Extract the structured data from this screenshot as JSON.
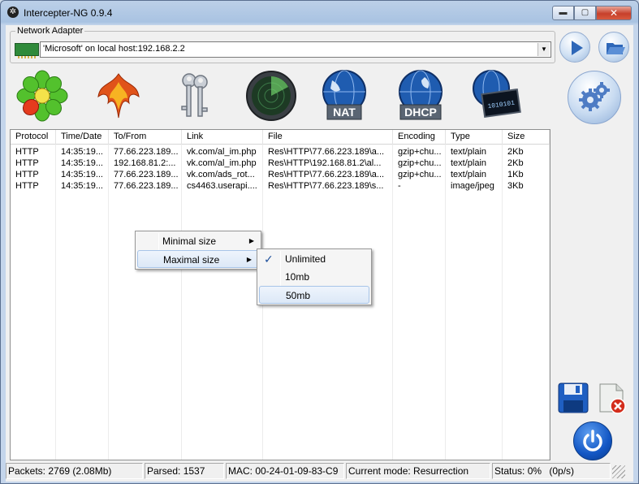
{
  "window": {
    "title": "Intercepter-NG 0.9.4"
  },
  "titlebar_buttons": {
    "minimize": "▬",
    "maximize": "▢",
    "close": "✕"
  },
  "adapter": {
    "group_label": "Network Adapter",
    "selected": "'Microsoft' on local host:192.168.2.2"
  },
  "toolbar": {
    "nat_label": "NAT",
    "dhcp_label": "DHCP",
    "binary_label": "1010101"
  },
  "table": {
    "columns": [
      "Protocol",
      "Time/Date",
      "To/From",
      "Link",
      "File",
      "Encoding",
      "Type",
      "Size"
    ],
    "rows": [
      [
        "HTTP",
        "14:35:19...",
        "77.66.223.189...",
        "vk.com/al_im.php",
        "Res\\HTTP\\77.66.223.189\\a...",
        "gzip+chu...",
        "text/plain",
        "2Kb"
      ],
      [
        "HTTP",
        "14:35:19...",
        "192.168.81.2:...",
        "vk.com/al_im.php",
        "Res\\HTTP\\192.168.81.2\\al...",
        "gzip+chu...",
        "text/plain",
        "2Kb"
      ],
      [
        "HTTP",
        "14:35:19...",
        "77.66.223.189...",
        "vk.com/ads_rot...",
        "Res\\HTTP\\77.66.223.189\\a...",
        "gzip+chu...",
        "text/plain",
        "1Kb"
      ],
      [
        "HTTP",
        "14:35:19...",
        "77.66.223.189...",
        "cs4463.userapi....",
        "Res\\HTTP\\77.66.223.189\\s...",
        "-",
        "image/jpeg",
        "3Kb"
      ]
    ]
  },
  "context_menu": {
    "items": [
      "Minimal size",
      "Maximal size"
    ]
  },
  "submenu": {
    "items": [
      "Unlimited",
      "10mb",
      "50mb"
    ],
    "checked": "Unlimited",
    "highlighted": "50mb"
  },
  "status": {
    "packets": "Packets: 2769 (2.08Mb)",
    "parsed": "Parsed: 1537",
    "mac": "MAC: 00-24-01-09-83-C9",
    "mode": "Current mode: Resurrection",
    "status": "Status: 0%",
    "rate": "(0p/s)"
  },
  "colors": {
    "title_bg": "#a9c3e2",
    "close_button": "#c7402b",
    "menu_highlight": "#dce8f7",
    "power_button": "#1256c4"
  },
  "icons": [
    "settings-gear-icon",
    "icq-flower-icon",
    "phoenix-icon",
    "keys-icon",
    "radar-icon",
    "nat-globe-icon",
    "dhcp-globe-icon",
    "network-cable-icon",
    "play-icon",
    "open-folder-icon",
    "save-icon",
    "clear-log-icon",
    "power-icon"
  ]
}
